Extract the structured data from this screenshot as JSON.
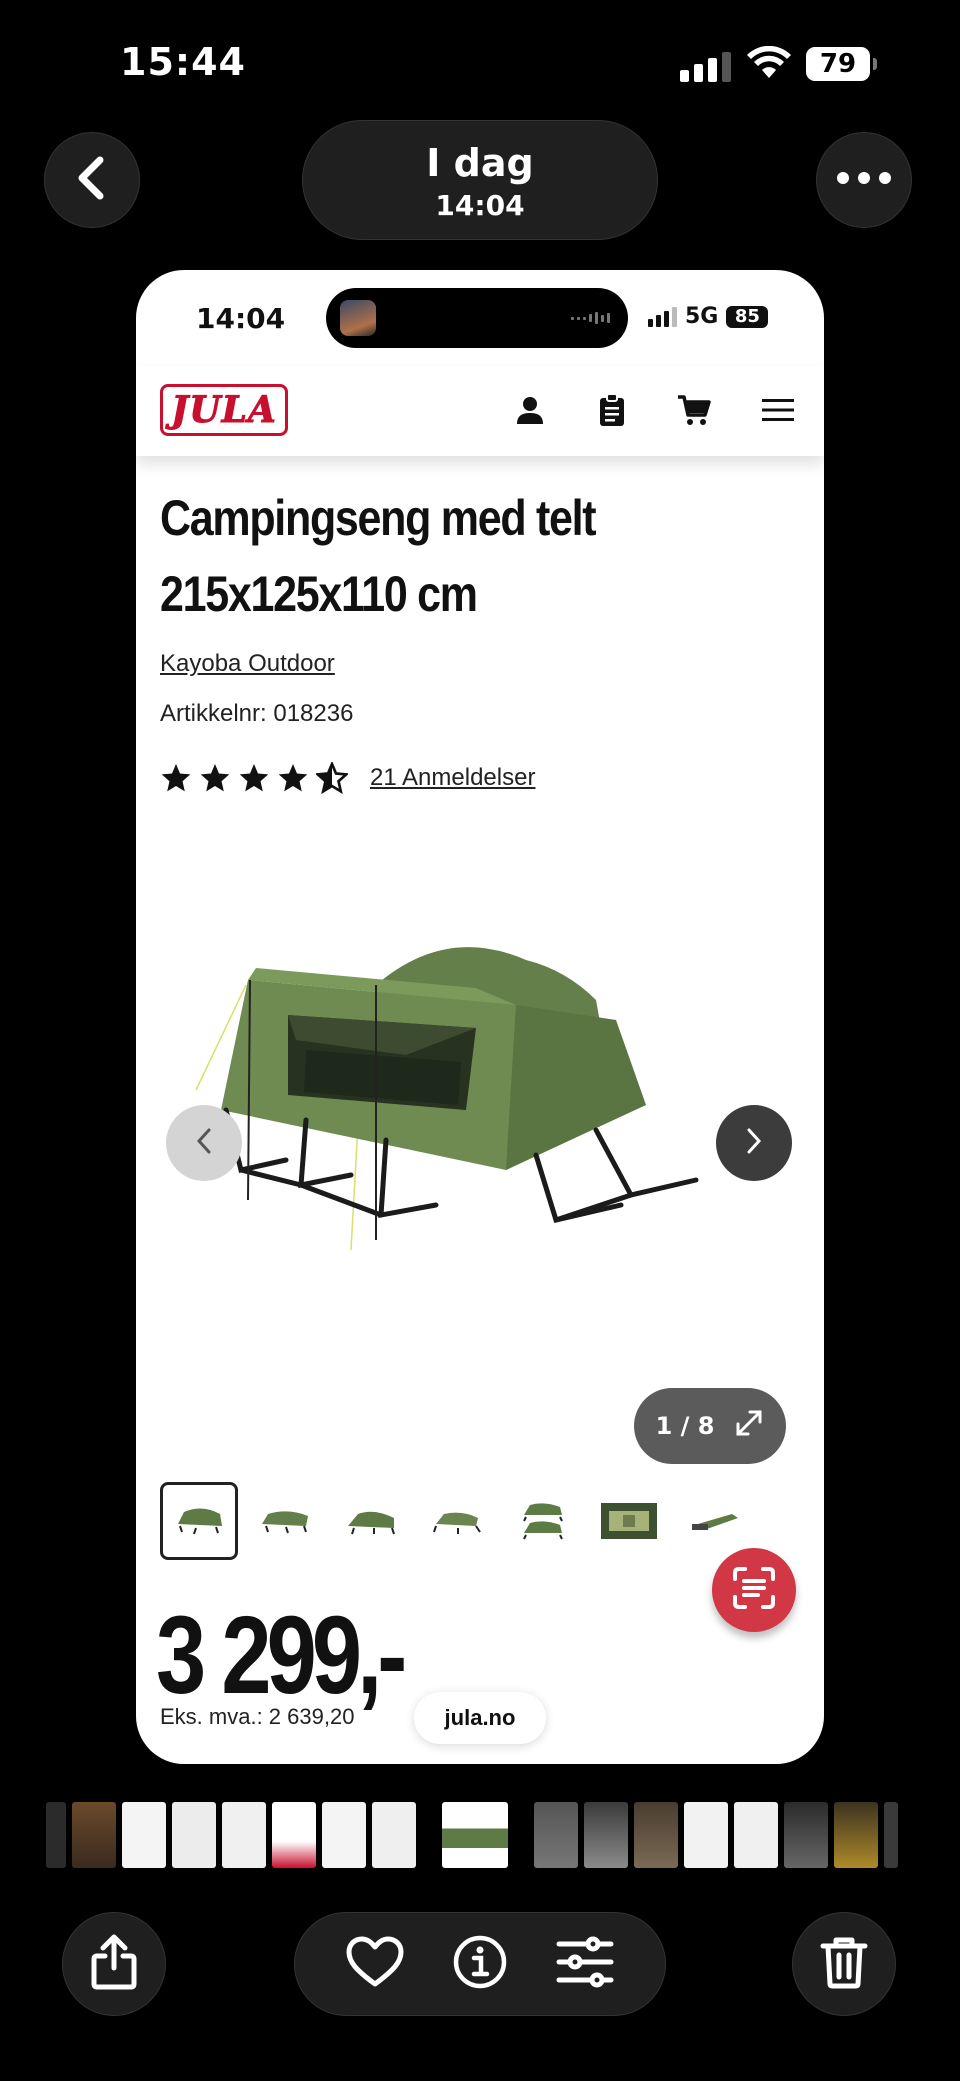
{
  "os_status": {
    "time": "15:44",
    "battery": "79"
  },
  "photo_header": {
    "date_label": "I dag",
    "time_label": "14:04"
  },
  "screenshot": {
    "status": {
      "time": "14:04",
      "network": "5G",
      "battery": "85"
    },
    "site": {
      "logo_text": "JULA",
      "url": "jula.no"
    },
    "product": {
      "title_line1": "Campingseng med telt",
      "title_line2": "215x125x110 cm",
      "brand": "Kayoba Outdoor",
      "article_number": "Artikkelnr: 018236",
      "rating": 4.5,
      "reviews": "21 Anmeldelser",
      "image_counter": "1 / 8",
      "price": "3 299,-",
      "ex_vat": "Eks. mva.: 2 639,20"
    }
  },
  "icons": {
    "back": "chevron-left-icon",
    "more": "ellipsis-icon",
    "share": "share-icon",
    "favorite": "heart-icon",
    "info": "info-icon",
    "adjust": "sliders-icon",
    "delete": "trash-icon"
  },
  "colors": {
    "jula_red": "#c8102e",
    "tent_green": "#5e7a45",
    "scan_red": "#d23745"
  }
}
